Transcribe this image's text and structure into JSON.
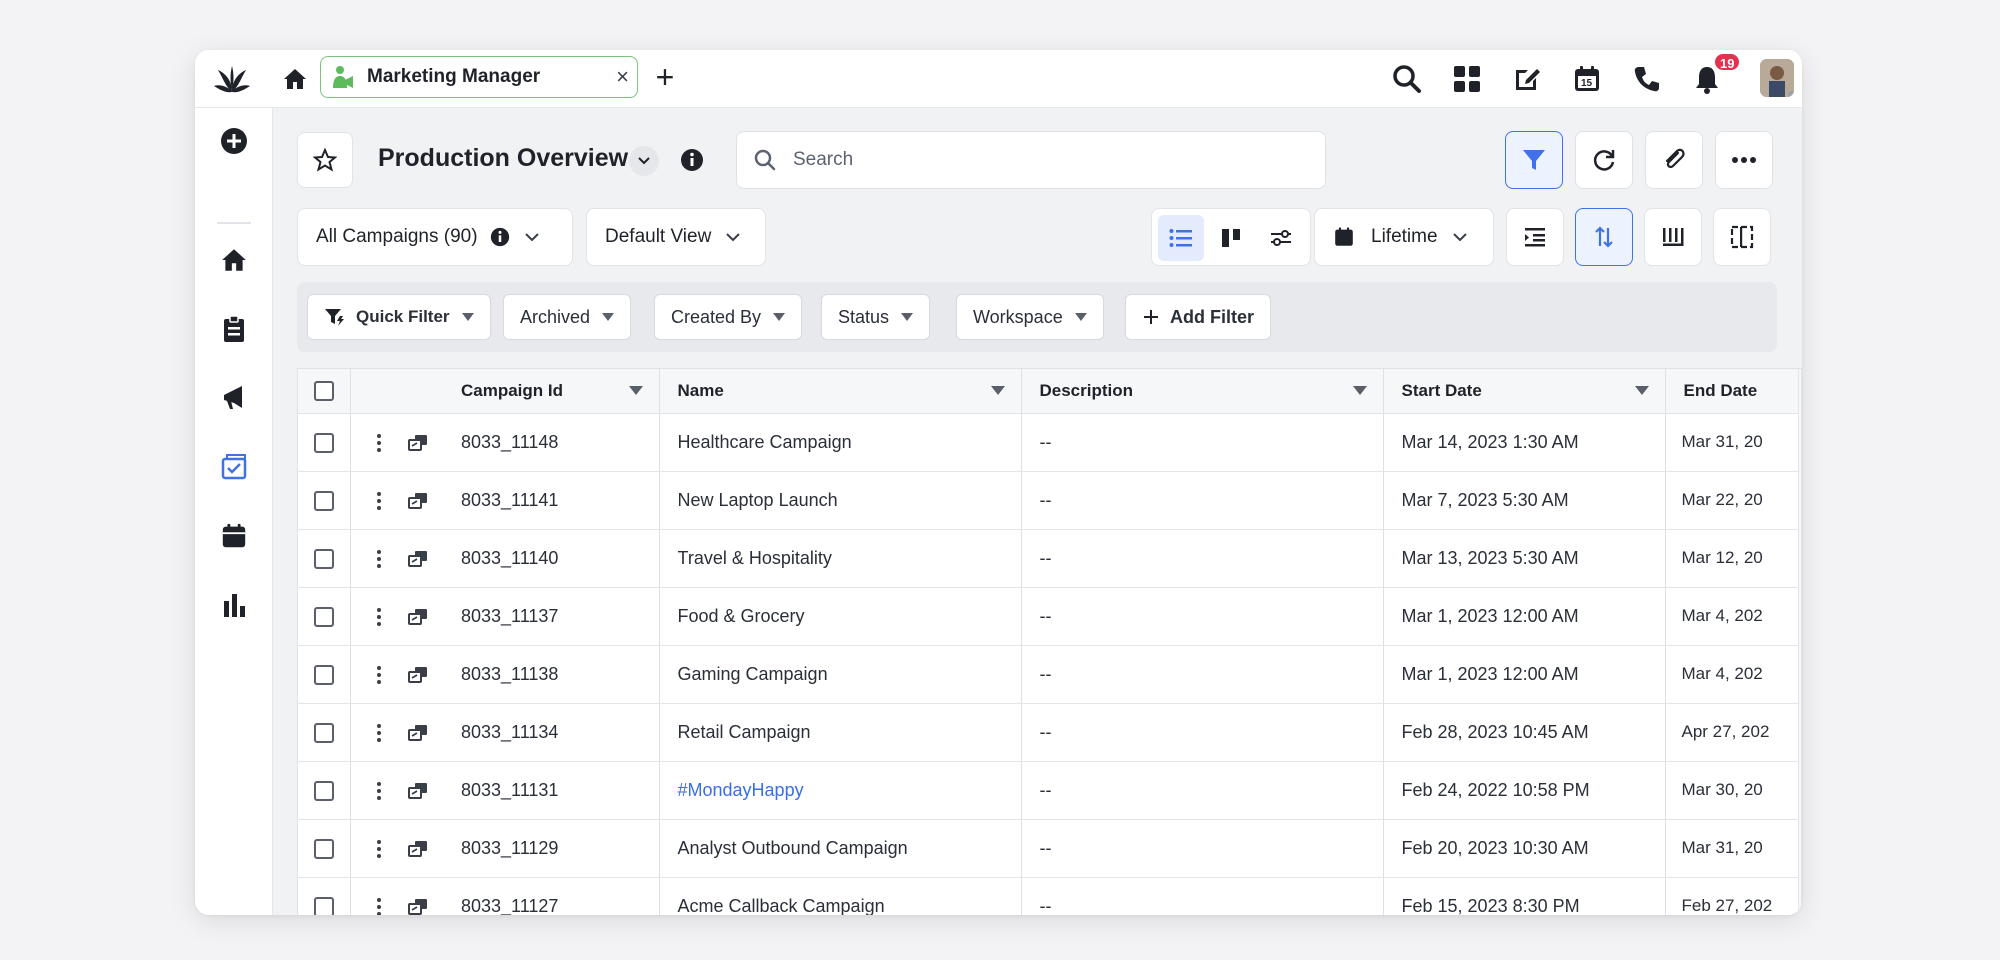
{
  "topbar": {
    "tab_label": "Marketing Manager",
    "tab_close": "×",
    "add_tab": "+",
    "notification_count": "19",
    "icons": [
      "search-icon",
      "apps-grid-icon",
      "compose-icon",
      "calendar-icon",
      "phone-icon",
      "bell-icon"
    ],
    "calendar_day": "15"
  },
  "sidenav": {
    "items": [
      "add-icon",
      "home-icon",
      "clipboard-icon",
      "megaphone-icon",
      "campaign-calendar-icon",
      "calendar-icon",
      "reports-icon"
    ],
    "active": "campaign-calendar-icon"
  },
  "header": {
    "title": "Production Overview",
    "search_placeholder": "Search"
  },
  "toolbar": {
    "campaigns_label": "All Campaigns (90)",
    "view_label": "Default View",
    "date_range_label": "Lifetime"
  },
  "filters": {
    "quick_filter": "Quick Filter",
    "archived": "Archived",
    "created_by": "Created By",
    "status": "Status",
    "workspace": "Workspace",
    "add_filter": "Add Filter"
  },
  "table": {
    "columns": [
      "Campaign Id",
      "Name",
      "Description",
      "Start Date",
      "End Date"
    ],
    "rows": [
      {
        "id": "8033_11148",
        "name": "Healthcare Campaign",
        "description": "--",
        "start": "Mar 14, 2023 1:30 AM",
        "end": "Mar 31, 20"
      },
      {
        "id": "8033_11141",
        "name": "New Laptop Launch",
        "description": "--",
        "start": "Mar 7, 2023 5:30 AM",
        "end": "Mar 22, 20"
      },
      {
        "id": "8033_11140",
        "name": "Travel & Hospitality",
        "description": "--",
        "start": "Mar 13, 2023 5:30 AM",
        "end": "Mar 12, 20"
      },
      {
        "id": "8033_11137",
        "name": "Food & Grocery",
        "description": "--",
        "start": "Mar 1, 2023 12:00 AM",
        "end": "Mar 4, 202"
      },
      {
        "id": "8033_11138",
        "name": "Gaming Campaign",
        "description": "--",
        "start": "Mar 1, 2023 12:00 AM",
        "end": "Mar 4, 202"
      },
      {
        "id": "8033_11134",
        "name": "Retail Campaign",
        "description": "--",
        "start": "Feb 28, 2023 10:45 AM",
        "end": "Apr 27, 202"
      },
      {
        "id": "8033_11131",
        "name": "#MondayHappy",
        "description": "--",
        "start": "Feb 24, 2022 10:58 PM",
        "end": "Mar 30, 20"
      },
      {
        "id": "8033_11129",
        "name": "Analyst Outbound Campaign",
        "description": "--",
        "start": "Feb 20, 2023 10:30 AM",
        "end": "Mar 31, 20"
      },
      {
        "id": "8033_11127",
        "name": "Acme Callback Campaign",
        "description": "--",
        "start": "Feb 15, 2023 8:30 PM",
        "end": "Feb 27, 202"
      }
    ]
  },
  "colors": {
    "accent": "#3f72e8",
    "tab_border": "#7cc47c",
    "badge": "#e5304f",
    "link": "#3a6ee8"
  }
}
